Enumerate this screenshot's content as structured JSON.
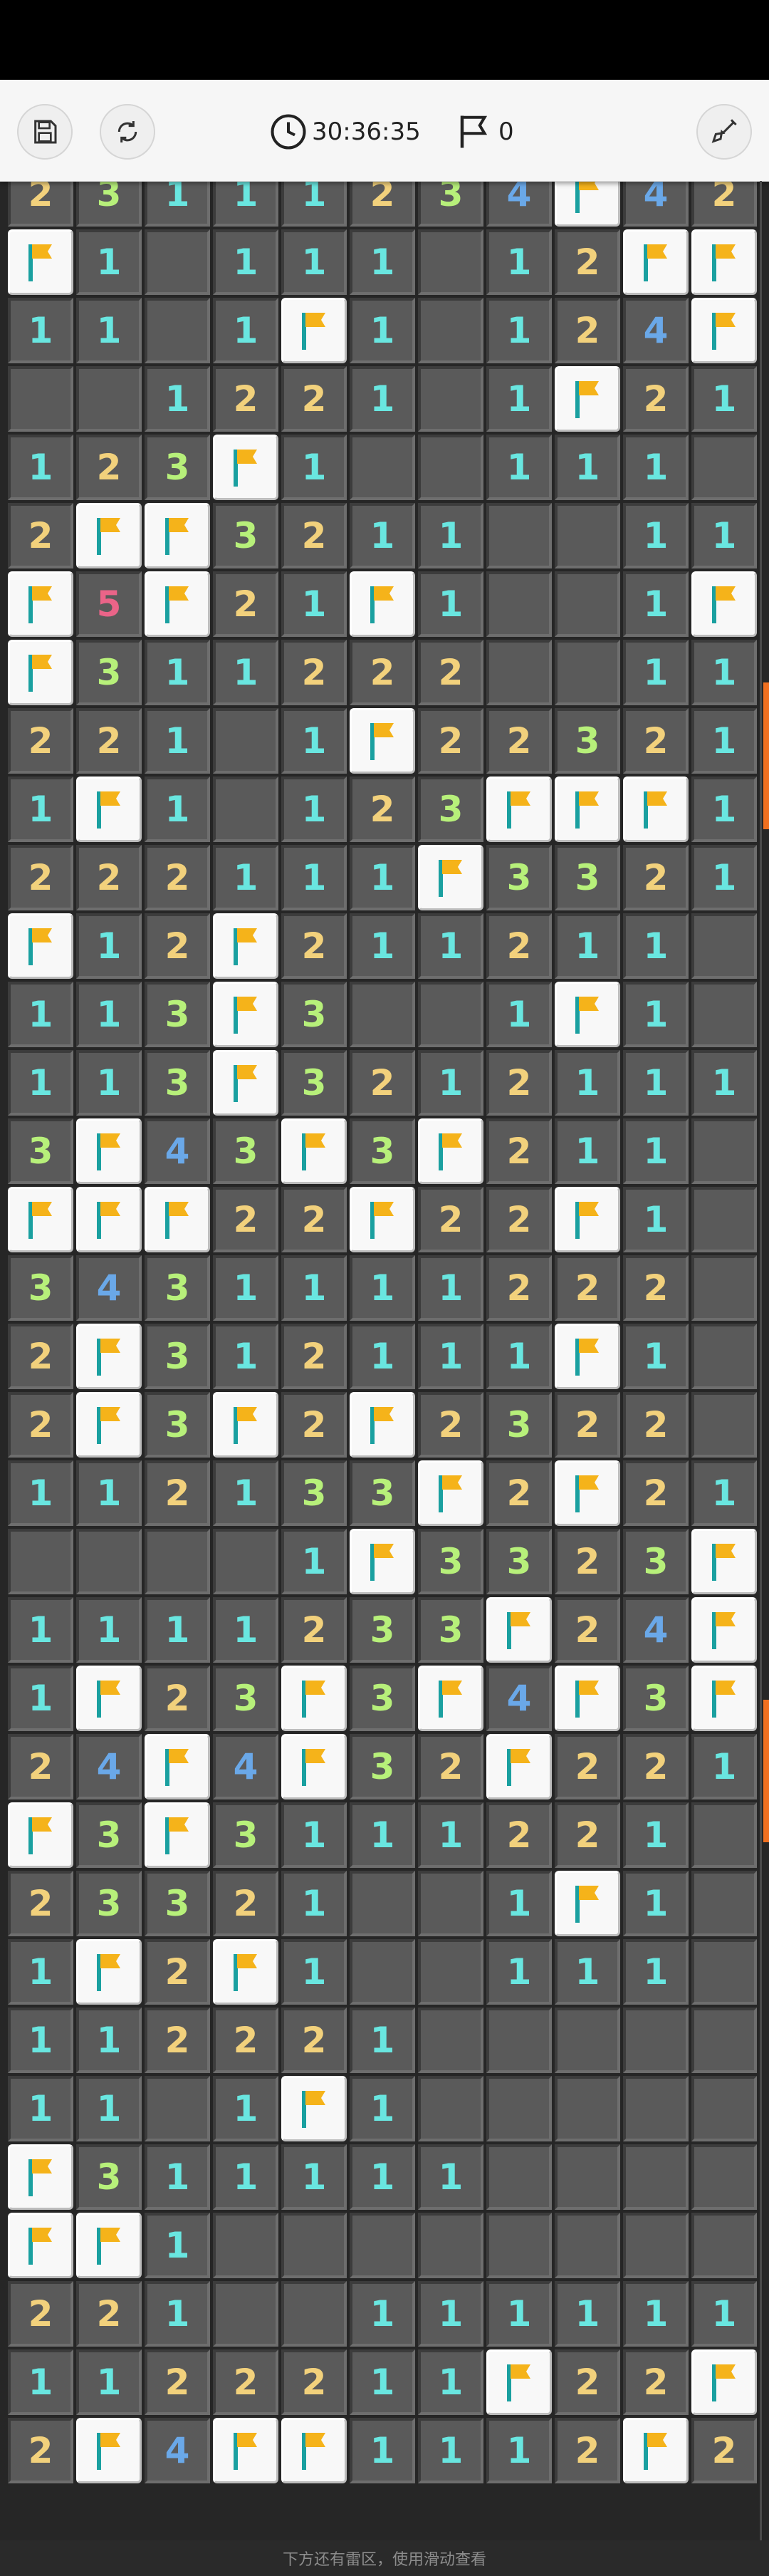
{
  "toolbar": {
    "timer": "30:36:35",
    "flag_count": "0",
    "icons": {
      "save": "save-icon",
      "restart": "refresh-icon",
      "timer": "clock-icon",
      "flags": "flag-icon",
      "tool": "shovel-icon"
    }
  },
  "board": {
    "columns": 11,
    "cell_legend": {
      "F": "flag",
      ".": "revealed-empty",
      "1-8": "adjacent-mine-count"
    },
    "rows": [
      "2311123 4F42",
      "F1.111.12FF",
      "11.1F1.124F",
      "..1221.1F21",
      "123F1..111.",
      "2FF3211..11",
      "F5F21F1..1F",
      "F311222..11",
      "221.1F22321",
      "1F1.123FFF1",
      "222111F3321",
      "F12F21121 1.",
      "113F3..1F1.",
      "113F3212111.",
      "3F43F3F211.",
      "FFF22F22F1.",
      "34311112 22.",
      "2F3121 11F1.",
      "2F3F2F2322.",
      "112133F2F21",
      "....1F3323F",
      "1111233F24F",
      "1F23F3F4F3F",
      "24F4F32F221",
      "F3F311122 1.",
      "23321..1F1.",
      "1F2F1..111.",
      "112221.....",
      "11.1F1.....",
      "F311111....",
      "FF1........",
      "221..11111 1",
      "1122211F22F",
      "2F4FF111 2F2"
    ]
  },
  "colors": {
    "n1": "#69e6e0",
    "n2": "#f2d17c",
    "n3": "#b7f07a",
    "n4": "#6aa8e8",
    "n5": "#ea6488",
    "accent": "#f07020"
  },
  "footer": {
    "hint": "下方还有雷区，使用滑动查看"
  }
}
